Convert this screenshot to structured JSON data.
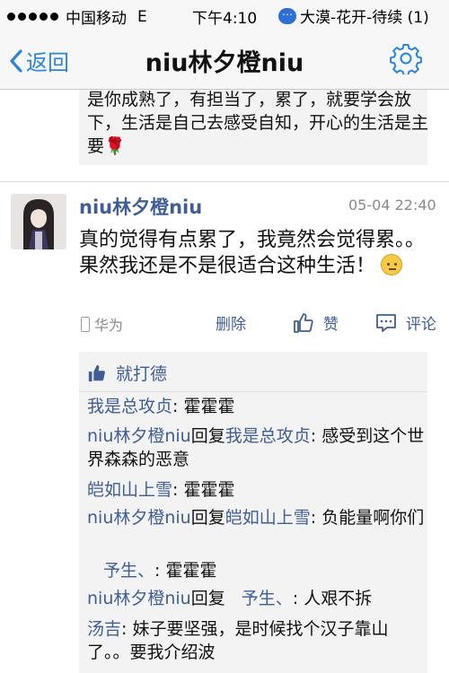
{
  "status_bar": {
    "carrier": "中国移动",
    "network": "E",
    "time": "下午4:10",
    "notification": "大漠-花开-待续 (1)"
  },
  "nav": {
    "back_label": "返回",
    "title": "niu林夕橙niu",
    "settings_icon": "gear-icon"
  },
  "previous_post_tail": {
    "text": "是你成熟了，有担当了，累了，就要学会放下，生活是自己去感受自知，开心的生活是主要",
    "emoji": "🌹"
  },
  "post": {
    "author": "niu林夕橙niu",
    "time": "05-04 22:40",
    "text": "真的觉得有点累了，我竟然会觉得累。。果然我还是不是很适合这种生活！",
    "device": "华为",
    "delete_label": "删除",
    "like_label": "赞",
    "comment_label": "评论"
  },
  "likes": {
    "names": "就打德"
  },
  "comments": [
    {
      "name": "我是总攻贞",
      "reply_to": "",
      "text": ": 霍霍霍"
    },
    {
      "name": "niu林夕橙niu",
      "reply_word": "回复",
      "reply_to": "我是总攻贞",
      "text": ": 感受到这个世界森森的恶意"
    },
    {
      "name": "皑如山上雪",
      "reply_to": "",
      "text": ": 霍霍霍"
    },
    {
      "name": "niu林夕橙niu",
      "reply_word": "回复",
      "reply_to": "皑如山上雪",
      "text": ": 负能量啊你们"
    },
    {
      "name": "予生、",
      "reply_to": "",
      "text": ": 霍霍霍"
    },
    {
      "name": "niu林夕橙niu",
      "reply_word": "回复",
      "reply_to": "予生、",
      "text": ": 人艰不拆"
    },
    {
      "name": "汤吉",
      "reply_to": "",
      "text": ": 妹子要坚强，是时候找个汉子靠山了。。要我介绍波"
    }
  ],
  "colors": {
    "link_blue": "#3f5e96",
    "ios_blue": "#2b86d9",
    "panel_bg": "#f3f3f3"
  }
}
